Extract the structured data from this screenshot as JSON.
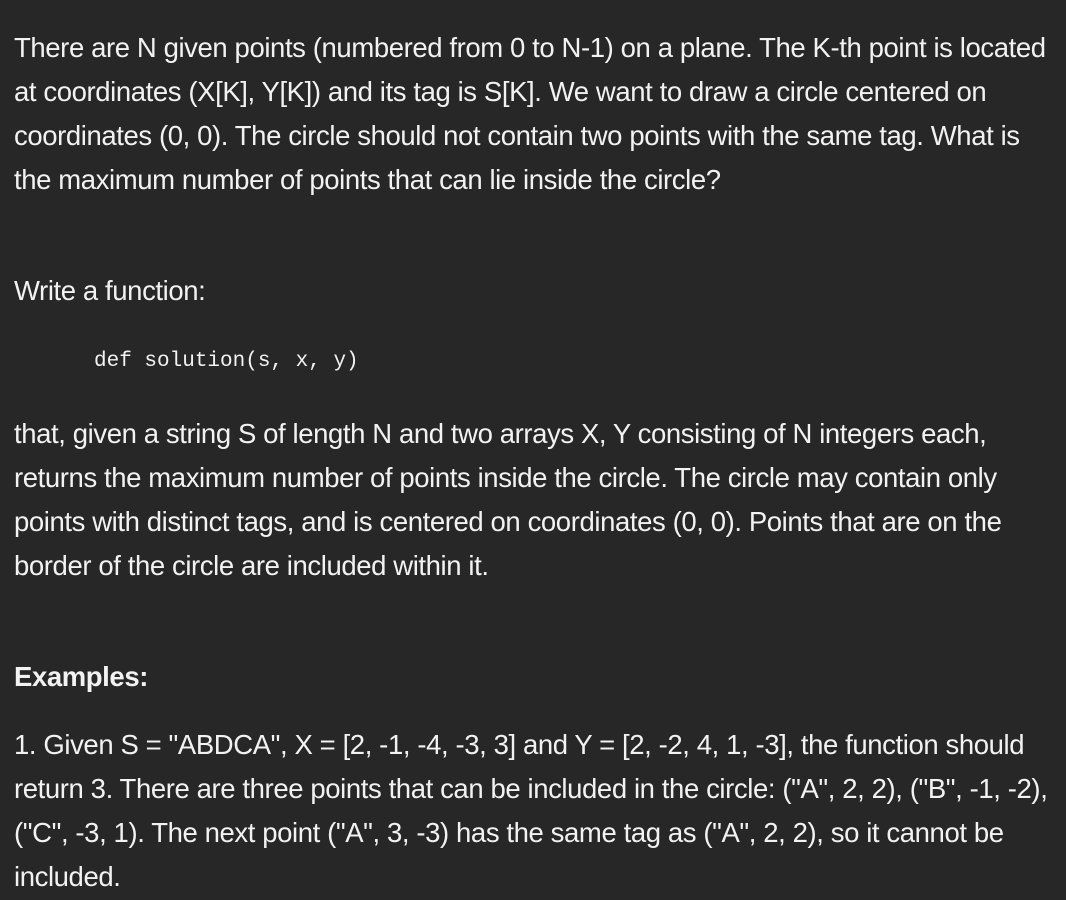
{
  "intro": "There are N given points (numbered from 0 to N-1) on a plane. The K-th point is located at coordinates (X[K], Y[K]) and its tag is S[K]. We want to draw a circle centered on coordinates (0, 0). The circle should not contain two points with the same tag. What is the maximum number of points that can lie inside the circle?",
  "write_function": "Write a function:",
  "code": "def solution(s, x, y)",
  "description": "that, given a string S of length N and two arrays X, Y consisting of N integers each, returns the maximum number of points inside the circle. The circle may contain only points with distinct tags, and is centered on coordinates (0, 0). Points that are on the border of the circle are included within it.",
  "examples_heading": "Examples:",
  "example_1": "1. Given S = \"ABDCA\", X = [2, -1, -4, -3, 3] and Y = [2, -2, 4, 1, -3], the function should return 3. There are three points that can be included in the circle: (\"A\", 2, 2), (\"B\", -1, -2), (\"C\", -3, 1). The next point (\"A\", 3, -3) has the same tag as (\"A\", 2, 2), so it cannot be included."
}
